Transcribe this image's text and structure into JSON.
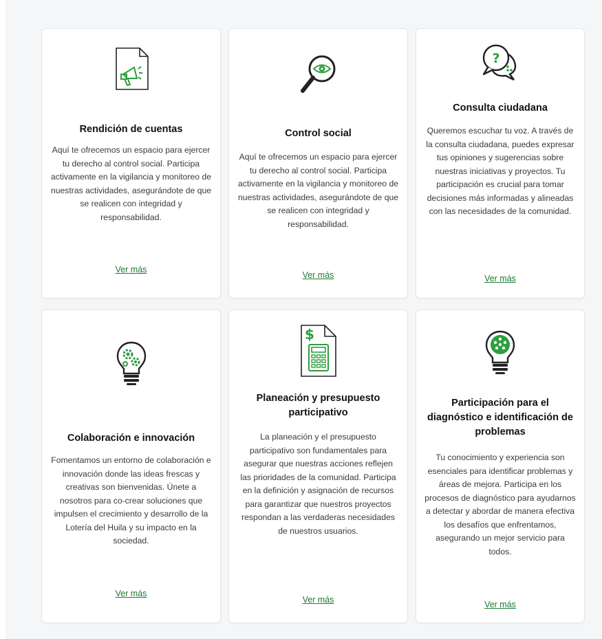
{
  "colors": {
    "accent": "#1d7a2e",
    "icon_green": "#2e9e3e",
    "icon_dark": "#222222"
  },
  "cards": [
    {
      "icon": "megaphone-document-icon",
      "title": "Rendición de cuentas",
      "description": "Aquí te ofrecemos un espacio para ejercer tu derecho al control social. Participa activamente en la vigilancia y monitoreo de nuestras actividades, asegurándote de que se realicen con integridad y responsabilidad.",
      "link": "Ver más"
    },
    {
      "icon": "magnifying-glass-eye-icon",
      "title": "Control social",
      "description": "Aquí te ofrecemos un espacio para ejercer tu derecho al control social. Participa activamente en la vigilancia y monitoreo de nuestras actividades, asegurándote de que se realicen con integridad y responsabilidad.",
      "link": "Ver más"
    },
    {
      "icon": "speech-bubbles-question-icon",
      "title": "Consulta ciudadana",
      "description": "Queremos escuchar tu voz. A través de la consulta ciudadana, puedes expresar tus opiniones y sugerencias sobre nuestras iniciativas y proyectos. Tu participación es crucial para tomar decisiones más informadas y alineadas con las necesidades de la comunidad.",
      "link": "Ver más"
    },
    {
      "icon": "lightbulb-gears-icon",
      "title": "Colaboración e innovación",
      "description": "Fomentamos un entorno de colaboración e innovación donde las ideas frescas y creativas son bienvenidas. Únete a nosotros para co-crear soluciones que impulsen el crecimiento y desarrollo de la Lotería del Huila y su impacto en la sociedad.",
      "link": "Ver más"
    },
    {
      "icon": "budget-calculator-document-icon",
      "title": "Planeación y presupuesto participativo",
      "description": "La planeación y el presupuesto participativo son fundamentales para asegurar que nuestras acciones reflejen las prioridades de la comunidad. Participa en la definición y asignación de recursos para garantizar que nuestros proyectos respondan a las verdaderas necesidades de nuestros usuarios.",
      "link": "Ver más"
    },
    {
      "icon": "lightbulb-people-icon",
      "title": "Participación para el diagnóstico e identificación de problemas",
      "description": "Tu conocimiento y experiencia son esenciales para identificar problemas y áreas de mejora. Participa en los procesos de diagnóstico para ayudarnos a detectar y abordar de manera efectiva los desafíos que enfrentamos, asegurando un mejor servicio para todos.",
      "link": "Ver más"
    }
  ]
}
